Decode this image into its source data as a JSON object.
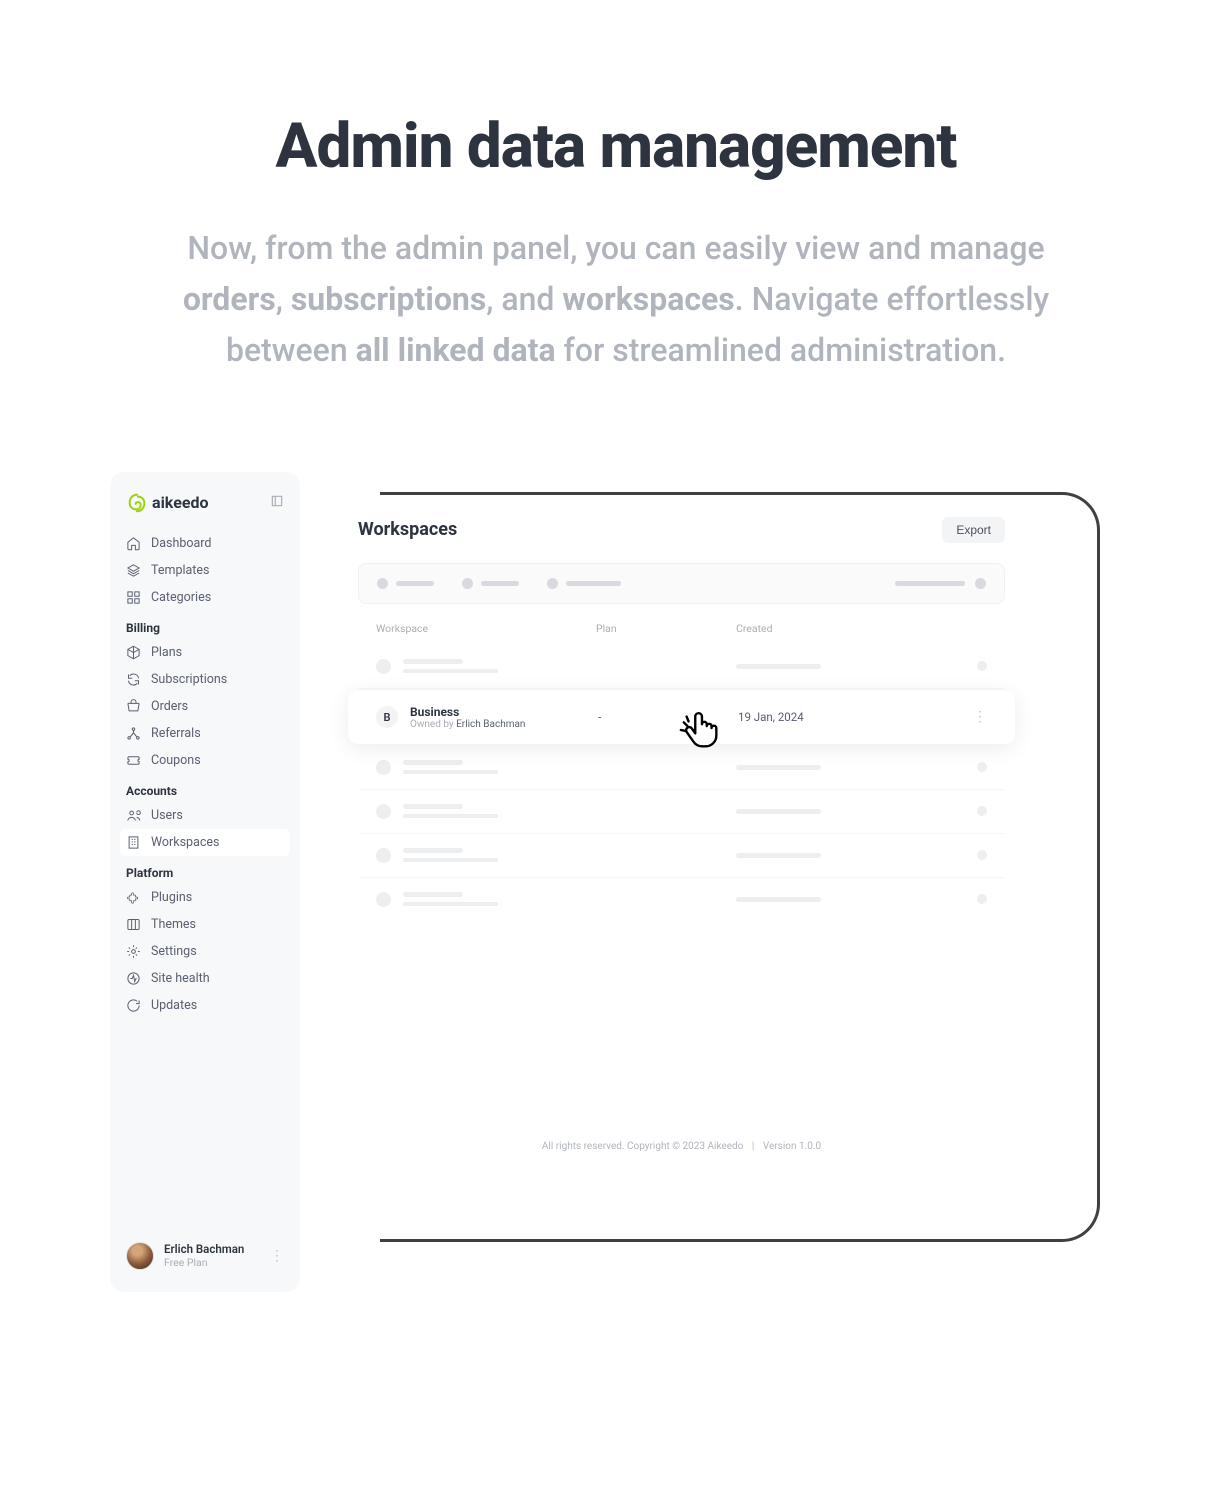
{
  "hero": {
    "title": "Admin data management",
    "text_pre": "Now, from the admin panel, you can easily view and manage ",
    "bold1": "orders",
    "sep1": ", ",
    "bold2": "subscriptions",
    "sep2": ", and ",
    "bold3": "workspaces",
    "text_mid": ". Navigate effortlessly between ",
    "bold4": "all linked data",
    "text_end": " for streamlined administration."
  },
  "sidebar": {
    "brand": "aikeedo",
    "nav1": {
      "dashboard": "Dashboard",
      "templates": "Templates",
      "categories": "Categories"
    },
    "billing_title": "Billing",
    "billing": {
      "plans": "Plans",
      "subscriptions": "Subscriptions",
      "orders": "Orders",
      "referrals": "Referrals",
      "coupons": "Coupons"
    },
    "accounts_title": "Accounts",
    "accounts": {
      "users": "Users",
      "workspaces": "Workspaces"
    },
    "platform_title": "Platform",
    "platform": {
      "plugins": "Plugins",
      "themes": "Themes",
      "settings": "Settings",
      "sitehealth": "Site health",
      "updates": "Updates"
    },
    "user": {
      "name": "Erlich Bachman",
      "plan": "Free Plan"
    }
  },
  "content": {
    "title": "Workspaces",
    "export": "Export",
    "columns": {
      "workspace": "Workspace",
      "plan": "Plan",
      "created": "Created"
    },
    "highlighted": {
      "avatar_letter": "B",
      "name": "Business",
      "owned_by_label": "Owned by ",
      "owner": "Erlich Bachman",
      "plan": "-",
      "created": "19 Jan, 2024"
    },
    "footer": {
      "copyright": "All rights reserved. Copyright © 2023 Aikeedo",
      "version": "Version 1.0.0"
    }
  }
}
